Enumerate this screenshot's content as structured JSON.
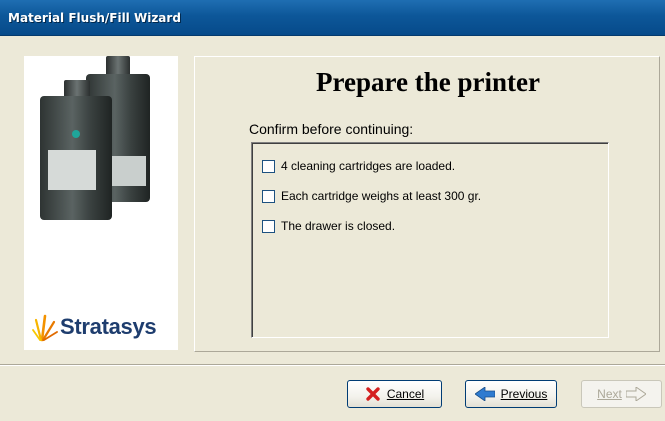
{
  "window": {
    "title": "Material Flush/Fill Wizard"
  },
  "sidebar": {
    "logo_text": "Stratasys"
  },
  "main": {
    "heading": "Prepare the printer",
    "confirm_label": "Confirm before continuing:",
    "checklist": [
      {
        "label": "4 cleaning cartridges are loaded.",
        "checked": false
      },
      {
        "label": "Each cartridge weighs at least 300 gr.",
        "checked": false
      },
      {
        "label": "The drawer is closed.",
        "checked": false
      }
    ]
  },
  "buttons": {
    "cancel": {
      "label": "Cancel",
      "accesskey": "C",
      "icon": "red-x-icon",
      "enabled": true
    },
    "previous": {
      "label": "Previous",
      "accesskey": "P",
      "icon": "blue-left-arrow-icon",
      "enabled": true
    },
    "next": {
      "label": "Next",
      "accesskey": "N",
      "icon": "right-arrow-icon",
      "enabled": false
    }
  },
  "colors": {
    "titlebar": "#0d5799",
    "window_bg": "#ece9d8",
    "logo_blue": "#1e3d6e",
    "logo_orange": "#f39200",
    "cancel_red": "#d42020",
    "prev_blue": "#2f7bd0"
  }
}
